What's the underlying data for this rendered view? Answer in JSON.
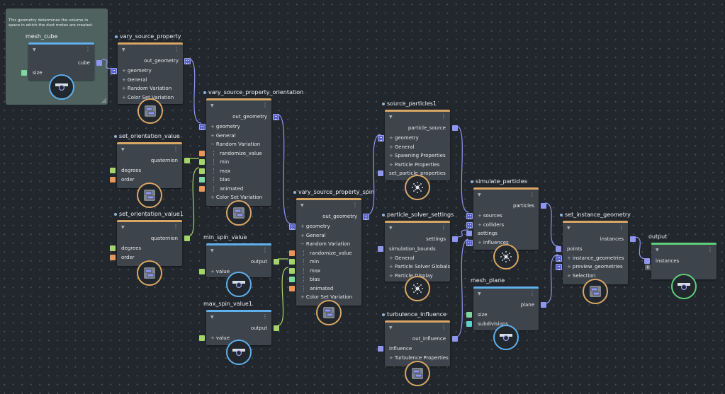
{
  "comment": {
    "text": "This geometry determines the volume in space in which the dust motes are created."
  },
  "colors": {
    "vector": "#8f96f0",
    "bool": "#a5d46a",
    "int": "#e8965a",
    "float": "#7ed9a0",
    "cyan": "#5fd0d0",
    "compound": "#d9a765",
    "value": "#5fb0ec",
    "terminal": "#5fd07a"
  },
  "nodes": [
    {
      "name": "mesh_cube",
      "accent": "value",
      "icon": "camera-icon",
      "rows": [
        {
          "label": "cube",
          "kind": "out",
          "port": "vector"
        },
        {
          "label": "size",
          "kind": "in",
          "port": "float"
        }
      ]
    },
    {
      "name": "vary_source_property",
      "accent": "compound",
      "icon": "compound-icon",
      "rows": [
        {
          "label": "out_geometry",
          "kind": "out",
          "port": "vector",
          "multi": true
        },
        {
          "label": "geometry",
          "kind": "grp",
          "port": "vector",
          "multi": true
        },
        {
          "label": "General",
          "kind": "grp"
        },
        {
          "label": "Random Variation",
          "kind": "grp"
        },
        {
          "label": "Color Set Variation",
          "kind": "grp"
        }
      ]
    },
    {
      "name": "set_orientation_value",
      "accent": "compound",
      "icon": "compound-icon",
      "rows": [
        {
          "label": "quaternion",
          "kind": "out",
          "port": "bool",
          "multi": false
        },
        {
          "label": "degrees",
          "kind": "in",
          "port": "bool"
        },
        {
          "label": "order",
          "kind": "in",
          "port": "int"
        }
      ]
    },
    {
      "name": "set_orientation_value1",
      "accent": "compound",
      "icon": "compound-icon",
      "rows": [
        {
          "label": "quaternion",
          "kind": "out",
          "port": "bool"
        },
        {
          "label": "degrees",
          "kind": "in",
          "port": "bool"
        },
        {
          "label": "order",
          "kind": "in",
          "port": "int"
        }
      ]
    },
    {
      "name": "vary_source_property_orientation",
      "accent": "compound",
      "icon": "compound-icon",
      "rows": [
        {
          "label": "out_geometry",
          "kind": "out",
          "port": "vector",
          "multi": true
        },
        {
          "label": "geometry",
          "kind": "grp",
          "port": "vector",
          "multi": true
        },
        {
          "label": "General",
          "kind": "grp"
        },
        {
          "label": "Random Variation",
          "kind": "open"
        },
        {
          "label": "randomize_value",
          "kind": "sub",
          "port": "int"
        },
        {
          "label": "min",
          "kind": "sub",
          "port": "bool"
        },
        {
          "label": "max",
          "kind": "sub",
          "port": "bool"
        },
        {
          "label": "bias",
          "kind": "sub",
          "port": "float"
        },
        {
          "label": "animated",
          "kind": "sub",
          "port": "int"
        },
        {
          "label": "Color Set Variation",
          "kind": "grp"
        }
      ]
    },
    {
      "name": "min_spin_value",
      "accent": "value",
      "icon": "camera-icon",
      "rows": [
        {
          "label": "output",
          "kind": "out",
          "port": "bool"
        },
        {
          "label": "value",
          "kind": "grp",
          "port": "bool"
        }
      ]
    },
    {
      "name": "max_spin_value1",
      "accent": "value",
      "icon": "camera-icon",
      "rows": [
        {
          "label": "output",
          "kind": "out",
          "port": "bool"
        },
        {
          "label": "value",
          "kind": "grp",
          "port": "bool"
        }
      ]
    },
    {
      "name": "vary_source_property_spin",
      "accent": "compound",
      "icon": "compound-icon",
      "rows": [
        {
          "label": "out_geometry",
          "kind": "out",
          "port": "vector",
          "multi": true
        },
        {
          "label": "geometry",
          "kind": "grp",
          "port": "vector",
          "multi": true
        },
        {
          "label": "General",
          "kind": "grp"
        },
        {
          "label": "Random Variation",
          "kind": "open"
        },
        {
          "label": "randomize_value",
          "kind": "sub",
          "port": "int"
        },
        {
          "label": "min",
          "kind": "sub",
          "port": "bool"
        },
        {
          "label": "max",
          "kind": "sub",
          "port": "bool"
        },
        {
          "label": "bias",
          "kind": "sub",
          "port": "float"
        },
        {
          "label": "animated",
          "kind": "sub",
          "port": "int"
        },
        {
          "label": "Color Set Variation",
          "kind": "grp"
        }
      ]
    },
    {
      "name": "source_particles1",
      "accent": "compound",
      "icon": "particles-icon",
      "rows": [
        {
          "label": "particle_source",
          "kind": "out",
          "port": "vector"
        },
        {
          "label": "geometry",
          "kind": "grp",
          "port": "vector",
          "multi": true
        },
        {
          "label": "General",
          "kind": "grp"
        },
        {
          "label": "Spawning Properties",
          "kind": "grp"
        },
        {
          "label": "Particle Properties",
          "kind": "grp"
        },
        {
          "label": "set_particle_properties",
          "kind": "in",
          "port": "vector"
        }
      ]
    },
    {
      "name": "particle_solver_settings",
      "accent": "compound",
      "icon": "particles-icon",
      "rows": [
        {
          "label": "settings",
          "kind": "out",
          "port": "vector"
        },
        {
          "label": "simulation_bounds",
          "kind": "in",
          "port": "vector"
        },
        {
          "label": "General",
          "kind": "grp"
        },
        {
          "label": "Particle Solver Globals",
          "kind": "grp"
        },
        {
          "label": "Particle Display",
          "kind": "grp"
        }
      ]
    },
    {
      "name": "turbulence_influence",
      "accent": "compound",
      "icon": "compound-icon",
      "rows": [
        {
          "label": "out_influence",
          "kind": "out",
          "port": "vector"
        },
        {
          "label": "influence",
          "kind": "in",
          "port": "vector"
        },
        {
          "label": "Turbulence Properties",
          "kind": "grp"
        }
      ]
    },
    {
      "name": "simulate_particles",
      "accent": "compound",
      "icon": "particles-icon",
      "rows": [
        {
          "label": "particles",
          "kind": "out",
          "port": "vector"
        },
        {
          "label": "sources",
          "kind": "grp",
          "port": "vector",
          "multi": true
        },
        {
          "label": "colliders",
          "kind": "grp",
          "port": "vector",
          "multi": true
        },
        {
          "label": "settings",
          "kind": "in",
          "port": "vector"
        },
        {
          "label": "influences",
          "kind": "grp",
          "port": "vector",
          "multi": true
        }
      ]
    },
    {
      "name": "mesh_plane",
      "accent": "value",
      "icon": "camera-icon",
      "rows": [
        {
          "label": "plane",
          "kind": "out",
          "port": "vector"
        },
        {
          "label": "size",
          "kind": "in",
          "port": "float"
        },
        {
          "label": "subdivisions",
          "kind": "in",
          "port": "cyan"
        }
      ]
    },
    {
      "name": "set_instance_geometry",
      "accent": "compound",
      "icon": "compound-icon",
      "rows": [
        {
          "label": "instances",
          "kind": "out",
          "port": "vector"
        },
        {
          "label": "points",
          "kind": "in",
          "port": "vector"
        },
        {
          "label": "instance_geometries",
          "kind": "grp",
          "port": "vector",
          "multi": true
        },
        {
          "label": "preview_geometries",
          "kind": "grp",
          "port": "vector",
          "multi": true
        },
        {
          "label": "Selection",
          "kind": "grp"
        }
      ]
    },
    {
      "name": "output",
      "accent": "terminal",
      "icon": "camera-icon",
      "rows": [
        {
          "label": "instances",
          "kind": "in",
          "port": "vector"
        }
      ]
    }
  ],
  "output_add_port": "+"
}
